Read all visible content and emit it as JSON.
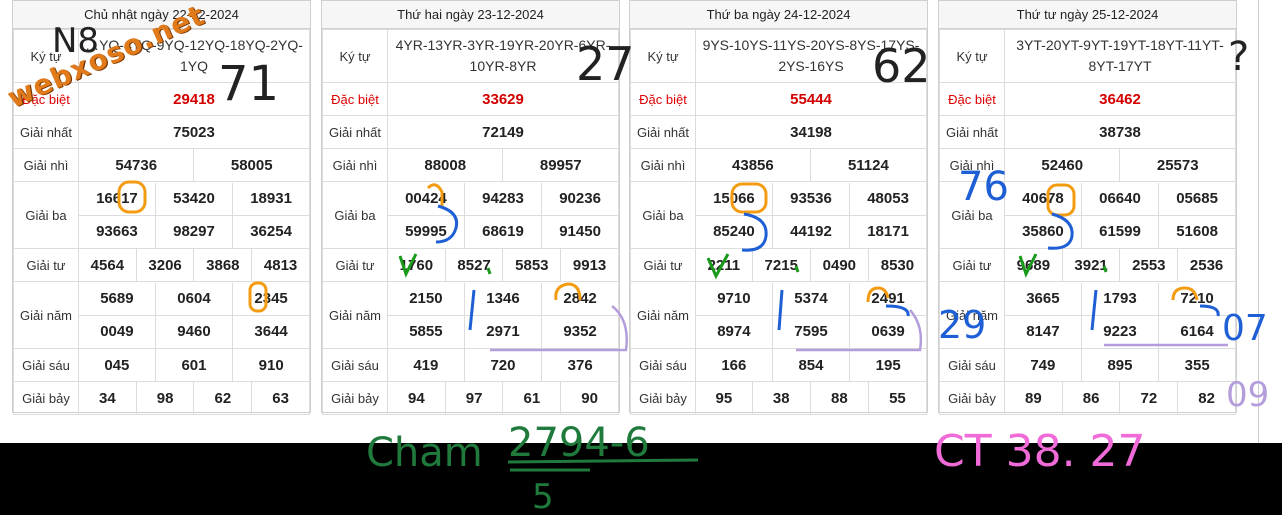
{
  "days": [
    {
      "date": "Chủ nhật ngày 22-12-2024",
      "kytu": "…YQ-4YQ-9YQ-12YQ-18YQ-2YQ-1YQ",
      "labels": {
        "special": "Đặc biệt",
        "g1": "Giải nhất",
        "g2": "Giải nhì",
        "g3": "Giải ba",
        "g4": "Giải tư",
        "g5": "Giải năm",
        "g6": "Giải sáu",
        "g7": "Giải bảy",
        "kytu": "Ký tự"
      },
      "special": "29418",
      "g1": "75023",
      "g2": [
        "54736",
        "58005"
      ],
      "g3": [
        "16617",
        "53420",
        "18931",
        "93663",
        "98297",
        "36254"
      ],
      "g4": [
        "4564",
        "3206",
        "3868",
        "4813"
      ],
      "g5": [
        "5689",
        "0604",
        "2345",
        "0049",
        "9460",
        "3644"
      ],
      "g6": [
        "045",
        "601",
        "910"
      ],
      "g7": [
        "34",
        "98",
        "62",
        "63"
      ]
    },
    {
      "date": "Thứ hai ngày 23-12-2024",
      "kytu": "4YR-13YR-3YR-19YR-20YR-6YR-10YR-8YR",
      "labels": {
        "special": "Đặc biệt",
        "g1": "Giải nhất",
        "g2": "Giải nhì",
        "g3": "Giải ba",
        "g4": "Giải tư",
        "g5": "Giải năm",
        "g6": "Giải sáu",
        "g7": "Giải bảy",
        "kytu": "Ký tự"
      },
      "special": "33629",
      "g1": "72149",
      "g2": [
        "88008",
        "89957"
      ],
      "g3": [
        "00424",
        "94283",
        "90236",
        "59995",
        "68619",
        "91450"
      ],
      "g4": [
        "1760",
        "8527",
        "5853",
        "9913"
      ],
      "g5": [
        "2150",
        "1346",
        "2842",
        "5855",
        "2971",
        "9352"
      ],
      "g6": [
        "419",
        "720",
        "376"
      ],
      "g7": [
        "94",
        "97",
        "61",
        "90"
      ]
    },
    {
      "date": "Thứ ba ngày 24-12-2024",
      "kytu": "9YS-10YS-11YS-20YS-8YS-17YS-2YS-16YS",
      "labels": {
        "special": "Đặc biệt",
        "g1": "Giải nhất",
        "g2": "Giải nhì",
        "g3": "Giải ba",
        "g4": "Giải tư",
        "g5": "Giải năm",
        "g6": "Giải sáu",
        "g7": "Giải bảy",
        "kytu": "Ký tự"
      },
      "special": "55444",
      "g1": "34198",
      "g2": [
        "43856",
        "51124"
      ],
      "g3": [
        "15066",
        "93536",
        "48053",
        "85240",
        "44192",
        "18171"
      ],
      "g4": [
        "2211",
        "7215",
        "0490",
        "8530"
      ],
      "g5": [
        "9710",
        "5374",
        "2491",
        "8974",
        "7595",
        "0639"
      ],
      "g6": [
        "166",
        "854",
        "195"
      ],
      "g7": [
        "95",
        "38",
        "88",
        "55"
      ]
    },
    {
      "date": "Thứ tư ngày 25-12-2024",
      "kytu": "3YT-20YT-9YT-19YT-18YT-11YT-8YT-17YT",
      "labels": {
        "special": "Đặc biệt",
        "g1": "Giải nhất",
        "g2": "Giải nhì",
        "g3": "Giải ba",
        "g4": "Giải tư",
        "g5": "Giải năm",
        "g6": "Giải sáu",
        "g7": "Giải bảy",
        "kytu": "Ký tự"
      },
      "special": "36462",
      "g1": "38738",
      "g2": [
        "52460",
        "25573"
      ],
      "g3": [
        "40678",
        "06640",
        "05685",
        "35860",
        "61599",
        "51608"
      ],
      "g4": [
        "9689",
        "3921",
        "2553",
        "2536"
      ],
      "g5": [
        "3665",
        "1793",
        "7210",
        "8147",
        "9223",
        "6164"
      ],
      "g6": [
        "749",
        "895",
        "355"
      ],
      "g7": [
        "89",
        "86",
        "72",
        "82"
      ]
    }
  ],
  "logo": "webxoso.net",
  "annotations": {
    "n8": "N8",
    "n71": "71",
    "n27": "27",
    "n62": "62",
    "q": "?",
    "n76": "76",
    "n29": "29",
    "n07": "07",
    "n09": "09",
    "cham_label": "Cham",
    "cham_formula": "2794-6",
    "cham_sub": "5",
    "ct_label": "CT 38. 27",
    "colors": {
      "orange": "#f39c12",
      "blue": "#1f5fd6",
      "green": "#1a9a1a",
      "purple": "#b39ddb",
      "pink": "#f06ad8",
      "dark_green": "#1f7a3c",
      "black": "#222222"
    }
  }
}
